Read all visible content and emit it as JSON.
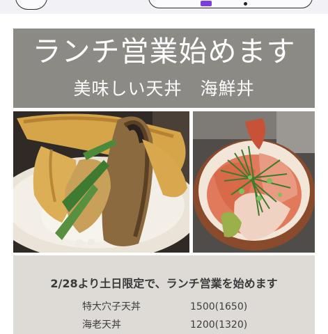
{
  "banner": {
    "title": "ランチ営業始めます",
    "subtitle": "美味しい天丼　海鮮丼"
  },
  "photos": [
    {
      "icon": "tempura-bowl-photo"
    },
    {
      "icon": "seafood-bowl-photo"
    }
  ],
  "info": {
    "headline": "2/28より土日限定で、ランチ営業を始めます",
    "menu": [
      {
        "name": "特大穴子天丼",
        "price": "1500(1650)"
      },
      {
        "name": "海老天丼",
        "price": "1200(1320)"
      }
    ]
  },
  "colors": {
    "banner": "#8c8a84",
    "panel": "#dedbd6",
    "accent": "#7b3fe0"
  }
}
